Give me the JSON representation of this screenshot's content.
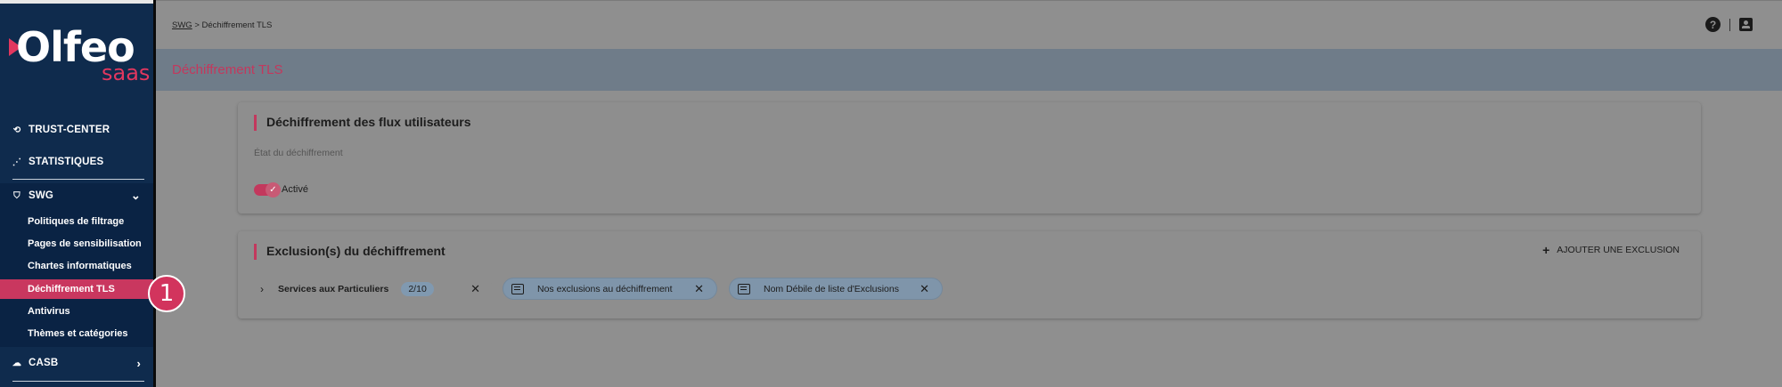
{
  "logo": {
    "brand": "Olfeo",
    "sub": "saas"
  },
  "sidebar": {
    "items": [
      {
        "label": "TRUST-CENTER",
        "icon": "trust-center-icon"
      },
      {
        "label": "STATISTIQUES",
        "icon": "statistics-icon"
      },
      {
        "label": "SWG",
        "icon": "shield-icon"
      }
    ],
    "swg_submenu": [
      "Politiques de filtrage",
      "Pages de sensibilisation",
      "Chartes informatiques",
      "Déchiffrement TLS",
      "Antivirus",
      "Thèmes et catégories"
    ],
    "active_submenu": "Déchiffrement TLS",
    "casb": {
      "label": "CASB",
      "icon": "cloud-icon"
    }
  },
  "annotation_badge": "1",
  "breadcrumb": {
    "root": "SWG",
    "separator": " > ",
    "current": "Déchiffrement TLS"
  },
  "page": {
    "title": "Déchiffrement TLS"
  },
  "decryption_card": {
    "title": "Déchiffrement des flux utilisateurs",
    "field_label": "État du déchiffrement",
    "toggle_label": "Activé",
    "toggle_on": true
  },
  "exclusions_card": {
    "title": "Exclusion(s) du déchiffrement",
    "add_button": "AJOUTER UNE EXCLUSION",
    "chips": {
      "services": {
        "label": "Services aux Particuliers",
        "count": "2/10"
      },
      "list_a": "Nos exclusions au déchiffrement",
      "list_b": "Nom Débile de liste d'Exclusions"
    }
  },
  "colors": {
    "sidebar": "#0f2b4d",
    "accent": "#c3385d",
    "overlay": "#8f8f8f"
  }
}
